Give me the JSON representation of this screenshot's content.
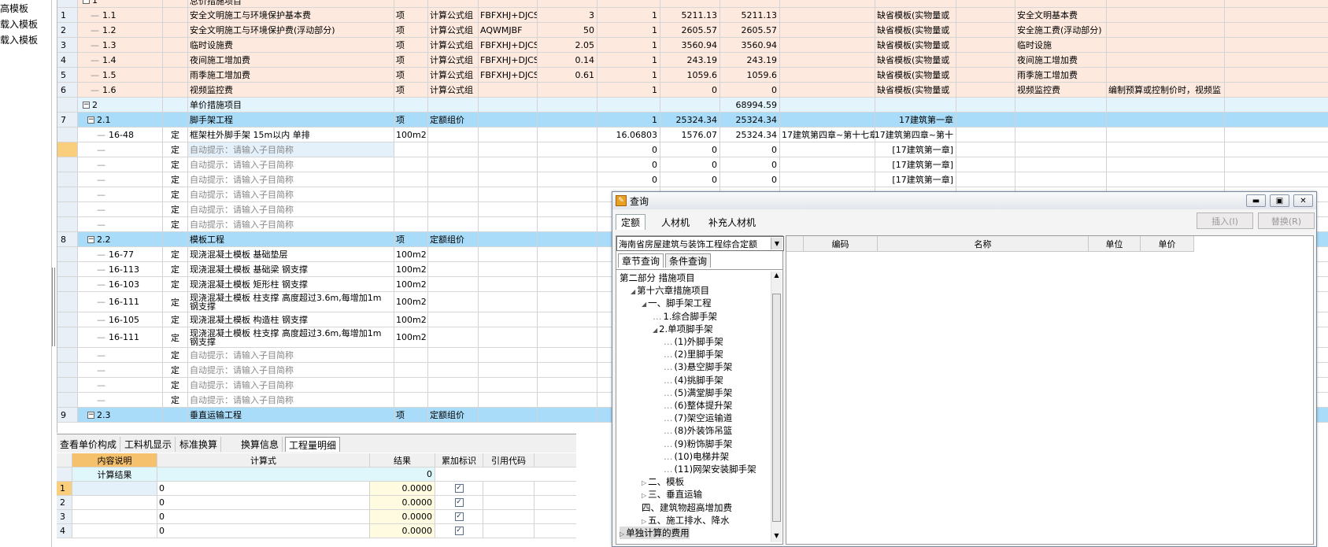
{
  "left_templates": [
    "高模板",
    "载入模板",
    "载入模板"
  ],
  "main_rows": [
    {
      "style": "pink",
      "idx": "",
      "code": "1",
      "name": "总价措施项目",
      "cost": "",
      "treeRoot": true,
      "partial": true
    },
    {
      "style": "pink",
      "idx": "1",
      "code": "1.1",
      "name": "安全文明施工与环境保护基本费",
      "unit": "项",
      "calc": "计算公式组",
      "base": "FBFXHJ+DJCSF",
      "rate": "3",
      "qty": "1",
      "price": "5211.13",
      "total": "5211.13",
      "tpl": "缺省模板(实物量或",
      "cat": "安全文明基本费",
      "note": ""
    },
    {
      "style": "pink",
      "idx": "2",
      "code": "1.2",
      "name": "安全文明施工与环境保护费(浮动部分)",
      "unit": "项",
      "calc": "计算公式组",
      "base": "AQWMJBF",
      "rate": "50",
      "qty": "1",
      "price": "2605.57",
      "total": "2605.57",
      "tpl": "缺省模板(实物量或",
      "cat": "安全施工费(浮动部分)",
      "note": ""
    },
    {
      "style": "pink",
      "idx": "3",
      "code": "1.3",
      "name": "临时设施费",
      "unit": "项",
      "calc": "计算公式组",
      "base": "FBFXHJ+DJCSF",
      "rate": "2.05",
      "qty": "1",
      "price": "3560.94",
      "total": "3560.94",
      "tpl": "缺省模板(实物量或",
      "cat": "临时设施",
      "note": ""
    },
    {
      "style": "pink",
      "idx": "4",
      "code": "1.4",
      "name": "夜间施工增加费",
      "unit": "项",
      "calc": "计算公式组",
      "base": "FBFXHJ+DJCSF",
      "rate": "0.14",
      "qty": "1",
      "price": "243.19",
      "total": "243.19",
      "tpl": "缺省模板(实物量或",
      "cat": "夜间施工增加费",
      "note": ""
    },
    {
      "style": "pink",
      "idx": "5",
      "code": "1.5",
      "name": "雨季施工增加费",
      "unit": "项",
      "calc": "计算公式组",
      "base": "FBFXHJ+DJCSF",
      "rate": "0.61",
      "qty": "1",
      "price": "1059.6",
      "total": "1059.6",
      "tpl": "缺省模板(实物量或",
      "cat": "雨季施工增加费",
      "note": ""
    },
    {
      "style": "pink",
      "idx": "6",
      "code": "1.6",
      "name": "视频监控费",
      "unit": "项",
      "calc": "计算公式组",
      "base": "",
      "rate": "",
      "qty": "1",
      "price": "0",
      "total": "0",
      "tpl": "缺省模板(实物量或",
      "cat": "视频监控费",
      "note": "编制预算或控制价时，视频监"
    },
    {
      "style": "sec",
      "idx": "",
      "code": "2",
      "name": "单价措施项目",
      "total": "68994.59",
      "treeRoot": true
    },
    {
      "style": "blue",
      "idx": "7",
      "code": "2.1",
      "name": "脚手架工程",
      "unit": "项",
      "calc": "定额组价",
      "qty": "1",
      "price": "25324.34",
      "total": "25324.34",
      "cat2": "17建筑第一章",
      "sub": true
    },
    {
      "style": "white",
      "idx": "",
      "code": "16-48",
      "type": "定",
      "name": "框架柱外脚手架 15m以内 单排",
      "unit": "100m2",
      "qty": "16.06803",
      "price": "1576.07",
      "total": "25324.34",
      "chap": "17建筑第四章~第十七章",
      "cat2": "17建筑第四章~第十",
      "leaf": true
    },
    {
      "style": "white",
      "idx": "",
      "sel": true,
      "type": "定",
      "name": "自动提示：请输入子目简称",
      "hint": true,
      "qty": "0",
      "price": "0",
      "total": "0",
      "cat2": "[17建筑第一章]",
      "leaf": true,
      "nameBg": true
    },
    {
      "style": "white",
      "idx": "",
      "type": "定",
      "name": "自动提示：请输入子目简称",
      "hint": true,
      "qty": "0",
      "price": "0",
      "total": "0",
      "cat2": "[17建筑第一章]",
      "leaf": true
    },
    {
      "style": "white",
      "idx": "",
      "type": "定",
      "name": "自动提示：请输入子目简称",
      "hint": true,
      "qty": "0",
      "price": "0",
      "total": "0",
      "cat2": "[17建筑第一章]",
      "leaf": true
    },
    {
      "style": "white",
      "idx": "",
      "type": "定",
      "name": "自动提示：请输入子目简称",
      "hint": true,
      "leaf": true
    },
    {
      "style": "white",
      "idx": "",
      "type": "定",
      "name": "自动提示：请输入子目简称",
      "hint": true,
      "leaf": true
    },
    {
      "style": "white",
      "idx": "",
      "type": "定",
      "name": "自动提示：请输入子目简称",
      "hint": true,
      "leaf": true
    },
    {
      "style": "blue",
      "idx": "8",
      "code": "2.2",
      "name": "模板工程",
      "unit": "项",
      "calc": "定额组价",
      "sub": true
    },
    {
      "style": "white",
      "idx": "",
      "code": "16-77",
      "type": "定",
      "name": "现浇混凝土模板 基础垫层",
      "unit": "100m2",
      "leaf": true
    },
    {
      "style": "white",
      "idx": "",
      "code": "16-113",
      "type": "定",
      "name": "现浇混凝土模板 基础梁 钢支撑",
      "unit": "100m2",
      "leaf": true
    },
    {
      "style": "white",
      "idx": "",
      "code": "16-103",
      "type": "定",
      "name": "现浇混凝土模板 矩形柱 钢支撑",
      "unit": "100m2",
      "leaf": true
    },
    {
      "style": "white",
      "idx": "",
      "code": "16-111",
      "type": "定",
      "name": "现浇混凝土模板 柱支撑 高度超过3.6m,每增加1m 钢支撑",
      "unit": "100m2",
      "leaf": true,
      "tall": true
    },
    {
      "style": "white",
      "idx": "",
      "code": "16-105",
      "type": "定",
      "name": "现浇混凝土模板 构造柱 钢支撑",
      "unit": "100m2",
      "leaf": true
    },
    {
      "style": "white",
      "idx": "",
      "code": "16-111",
      "type": "定",
      "name": "现浇混凝土模板 柱支撑 高度超过3.6m,每增加1m 钢支撑",
      "unit": "100m2",
      "leaf": true,
      "tall": true
    },
    {
      "style": "white",
      "idx": "",
      "type": "定",
      "name": "自动提示：请输入子目简称",
      "hint": true,
      "leaf": true
    },
    {
      "style": "white",
      "idx": "",
      "type": "定",
      "name": "自动提示：请输入子目简称",
      "hint": true,
      "leaf": true
    },
    {
      "style": "white",
      "idx": "",
      "type": "定",
      "name": "自动提示：请输入子目简称",
      "hint": true,
      "leaf": true
    },
    {
      "style": "white",
      "idx": "",
      "type": "定",
      "name": "自动提示：请输入子目简称",
      "hint": true,
      "leaf": true
    },
    {
      "style": "blue",
      "idx": "9",
      "code": "2.3",
      "name": "垂直运输工程",
      "unit": "项",
      "calc": "定额组价",
      "sub": true
    }
  ],
  "bottom_tabs": [
    "查看单价构成",
    "工料机显示",
    "标准换算",
    "换算信息",
    "工程量明细"
  ],
  "sub_grid": {
    "headers": [
      "内容说明",
      "计算式",
      "结果",
      "累加标识",
      "引用代码"
    ],
    "result_label": "计算结果",
    "result_value": "0",
    "rows": [
      {
        "idx": "1",
        "expr": "0",
        "value": "0.0000",
        "check": "✓"
      },
      {
        "idx": "2",
        "expr": "0",
        "value": "0.0000",
        "check": "✓"
      },
      {
        "idx": "3",
        "expr": "0",
        "value": "0.0000",
        "check": "✓"
      },
      {
        "idx": "4",
        "expr": "0",
        "value": "0.0000",
        "check": "✓"
      }
    ]
  },
  "dialog": {
    "title": "查询",
    "tabs": [
      "定额",
      "人材机",
      "补充人材机"
    ],
    "insert_label": "插入(I)",
    "replace_label": "替换(R)",
    "combo_value": "海南省房屋建筑与装饰工程综合定额",
    "sub_tabs": [
      "章节查询",
      "条件查询"
    ],
    "tree": [
      {
        "t": "第二部分 措施项目",
        "lvl": 0,
        "g": ""
      },
      {
        "t": "第十六章措施项目",
        "lvl": 1,
        "g": "◢"
      },
      {
        "t": "一、脚手架工程",
        "lvl": 2,
        "g": "◢"
      },
      {
        "t": "1.综合脚手架",
        "lvl": 3,
        "g": ""
      },
      {
        "t": "2.单项脚手架",
        "lvl": 3,
        "g": "◢"
      },
      {
        "t": "(1)外脚手架",
        "lvl": 4,
        "g": ""
      },
      {
        "t": "(2)里脚手架",
        "lvl": 4,
        "g": ""
      },
      {
        "t": "(3)悬空脚手架",
        "lvl": 4,
        "g": ""
      },
      {
        "t": "(4)挑脚手架",
        "lvl": 4,
        "g": ""
      },
      {
        "t": "(5)满堂脚手架",
        "lvl": 4,
        "g": ""
      },
      {
        "t": "(6)整体提升架",
        "lvl": 4,
        "g": ""
      },
      {
        "t": "(7)架空运输道",
        "lvl": 4,
        "g": ""
      },
      {
        "t": "(8)外装饰吊篮",
        "lvl": 4,
        "g": ""
      },
      {
        "t": "(9)粉饰脚手架",
        "lvl": 4,
        "g": ""
      },
      {
        "t": "(10)电梯井架",
        "lvl": 4,
        "g": ""
      },
      {
        "t": "(11)网架安装脚手架",
        "lvl": 4,
        "g": ""
      },
      {
        "t": "二、模板",
        "lvl": 2,
        "g": "▷"
      },
      {
        "t": "三、垂直运输",
        "lvl": 2,
        "g": "▷"
      },
      {
        "t": "四、建筑物超高增加费",
        "lvl": 2,
        "g": ""
      },
      {
        "t": "五、施工排水、降水",
        "lvl": 2,
        "g": "▷"
      },
      {
        "t": "单独计算的费用",
        "lvl": 0,
        "g": "▷"
      }
    ],
    "result_headers": [
      "编码",
      "名称",
      "单位",
      "单价"
    ]
  }
}
